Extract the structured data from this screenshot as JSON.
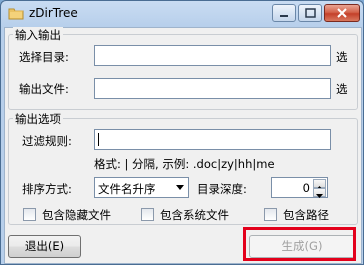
{
  "window": {
    "title": "zDirTree"
  },
  "io_group": {
    "title": "输入输出",
    "select_dir_label": "选择目录:",
    "select_dir_value": "",
    "select_dir_browse": "选",
    "output_file_label": "输出文件:",
    "output_file_value": "",
    "output_file_browse": "选"
  },
  "options_group": {
    "title": "输出选项",
    "filter_label": "过滤规则:",
    "filter_value": "",
    "format_hint": "格式: | 分隔, 示例: .doc|zy|hh|me",
    "sort_label": "排序方式:",
    "sort_value": "文件名升序",
    "depth_label": "目录深度:",
    "depth_value": "0",
    "include_hidden_label": "包含隐藏文件",
    "include_hidden_checked": false,
    "include_system_label": "包含系统文件",
    "include_system_checked": false,
    "include_path_label": "包含路径",
    "include_path_checked": false
  },
  "actions": {
    "exit_label": "退出(E)",
    "generate_label": "生成(G)",
    "generate_enabled": false
  },
  "colors": {
    "highlight": "#e3001b"
  }
}
